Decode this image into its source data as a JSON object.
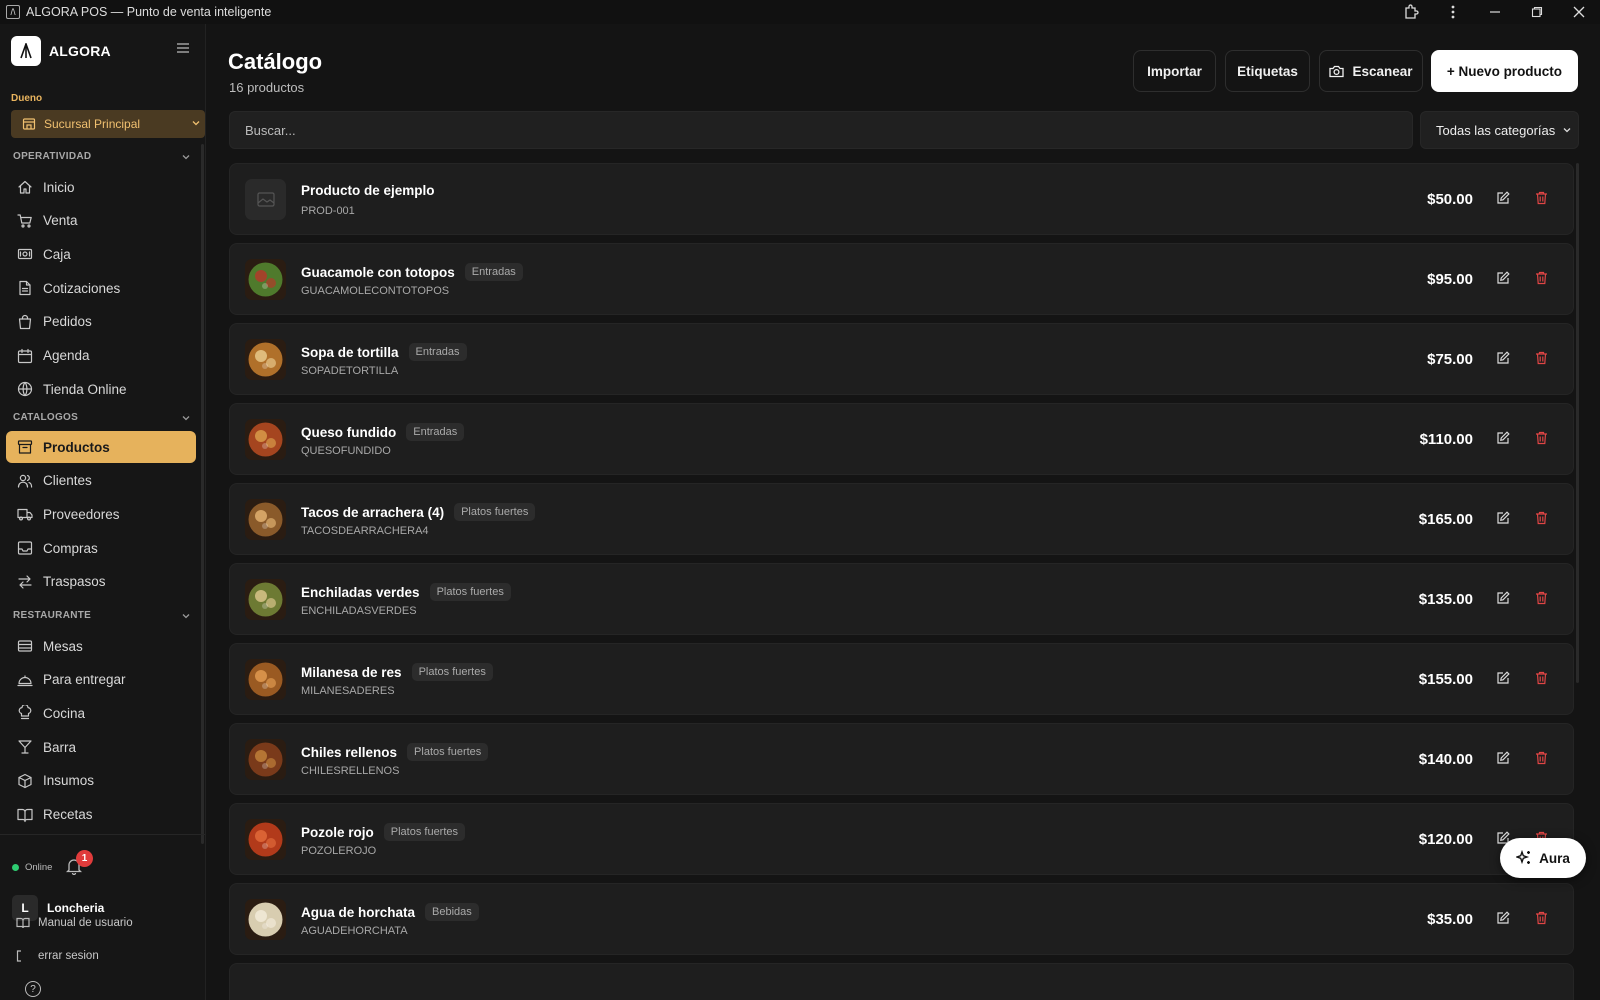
{
  "window": {
    "title": "ALGORA POS — Punto de venta inteligente"
  },
  "brand": {
    "name": "ALGORA"
  },
  "sidebar": {
    "role": "Dueno",
    "branch": "Sucursal Principal",
    "sections": {
      "operatividad": {
        "title": "OPERATIVIDAD",
        "items": [
          {
            "label": "Inicio",
            "icon": "home-icon"
          },
          {
            "label": "Venta",
            "icon": "cart-icon"
          },
          {
            "label": "Caja",
            "icon": "cash-register-icon"
          },
          {
            "label": "Cotizaciones",
            "icon": "document-icon"
          },
          {
            "label": "Pedidos",
            "icon": "bag-icon"
          },
          {
            "label": "Agenda",
            "icon": "calendar-icon"
          },
          {
            "label": "Tienda Online",
            "icon": "globe-icon"
          }
        ]
      },
      "catalogos": {
        "title": "CATALOGOS",
        "items": [
          {
            "label": "Productos",
            "icon": "archive-icon",
            "active": true
          },
          {
            "label": "Clientes",
            "icon": "users-icon"
          },
          {
            "label": "Proveedores",
            "icon": "truck-icon"
          },
          {
            "label": "Compras",
            "icon": "inbox-icon"
          },
          {
            "label": "Traspasos",
            "icon": "transfer-icon"
          }
        ]
      },
      "restaurante": {
        "title": "RESTAURANTE",
        "items": [
          {
            "label": "Mesas",
            "icon": "table-icon"
          },
          {
            "label": "Para entregar",
            "icon": "cloche-icon"
          },
          {
            "label": "Cocina",
            "icon": "chef-hat-icon"
          },
          {
            "label": "Barra",
            "icon": "cocktail-icon"
          },
          {
            "label": "Insumos",
            "icon": "box-icon"
          },
          {
            "label": "Recetas",
            "icon": "book-icon"
          }
        ]
      }
    },
    "status": "Online",
    "notifications": "1",
    "user": {
      "initial": "L",
      "name": "Loncheria"
    },
    "manual": "Manual de usuario",
    "logout": "errar sesion"
  },
  "header": {
    "title": "Catálogo",
    "subtitle": "16 productos",
    "buttons": {
      "import": "Importar",
      "labels": "Etiquetas",
      "scan": "Escanear",
      "new": "+ Nuevo producto"
    }
  },
  "search": {
    "placeholder": "Buscar..."
  },
  "filter": {
    "category": "Todas las categorías"
  },
  "products": [
    {
      "name": "Producto de ejemplo",
      "sku": "PROD-001",
      "category": "",
      "price": "$50.00",
      "thumb": "placeholder",
      "colors": [
        "#2a2a2a",
        "#2a2a2a"
      ]
    },
    {
      "name": "Guacamole con totopos",
      "sku": "GUACAMOLECONTOTOPOS",
      "category": "Entradas",
      "price": "$95.00",
      "thumb": "food",
      "colors": [
        "#4f7a2c",
        "#b23a2a"
      ]
    },
    {
      "name": "Sopa de tortilla",
      "sku": "SOPADETORTILLA",
      "category": "Entradas",
      "price": "$75.00",
      "thumb": "food",
      "colors": [
        "#b0702a",
        "#e8c88a"
      ]
    },
    {
      "name": "Queso fundido",
      "sku": "QUESOFUNDIDO",
      "category": "Entradas",
      "price": "$110.00",
      "thumb": "food",
      "colors": [
        "#a5451f",
        "#d89b4a"
      ]
    },
    {
      "name": "Tacos de arrachera (4)",
      "sku": "TACOSDEARRACHERA4",
      "category": "Platos fuertes",
      "price": "$165.00",
      "thumb": "food",
      "colors": [
        "#8a5a2a",
        "#e0b070"
      ]
    },
    {
      "name": "Enchiladas verdes",
      "sku": "ENCHILADASVERDES",
      "category": "Platos fuertes",
      "price": "$135.00",
      "thumb": "food",
      "colors": [
        "#6d7a33",
        "#d8c48a"
      ]
    },
    {
      "name": "Milanesa de res",
      "sku": "MILANESADERES",
      "category": "Platos fuertes",
      "price": "$155.00",
      "thumb": "food",
      "colors": [
        "#9a5a22",
        "#e09a50"
      ]
    },
    {
      "name": "Chiles rellenos",
      "sku": "CHILESRELLENOS",
      "category": "Platos fuertes",
      "price": "$140.00",
      "thumb": "food",
      "colors": [
        "#7a3a1a",
        "#c0803a"
      ]
    },
    {
      "name": "Pozole rojo",
      "sku": "POZOLEROJO",
      "category": "Platos fuertes",
      "price": "$120.00",
      "thumb": "food",
      "colors": [
        "#b23a1a",
        "#e06a3a"
      ]
    },
    {
      "name": "Agua de horchata",
      "sku": "AGUADEHORCHATA",
      "category": "Bebidas",
      "price": "$35.00",
      "thumb": "food",
      "colors": [
        "#d8cdb0",
        "#f2ead8"
      ]
    }
  ],
  "assistant": {
    "label": "Aura"
  },
  "colors": {
    "accent": "#e6b25c",
    "danger": "#e04545",
    "online": "#2ecc71"
  }
}
